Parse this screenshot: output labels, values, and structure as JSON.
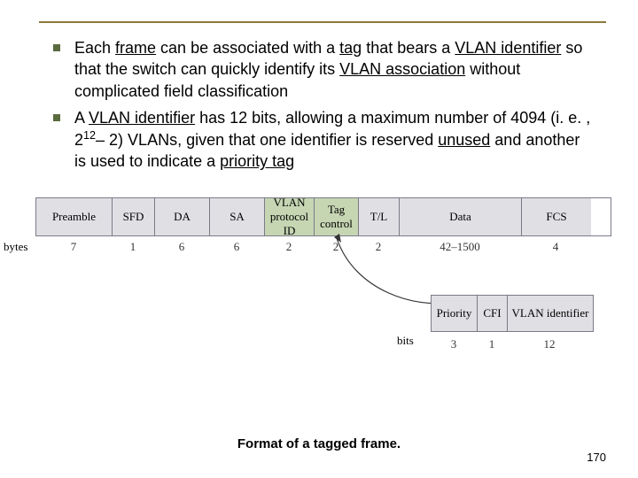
{
  "bullets": [
    {
      "pre1": "Each ",
      "u1": "frame",
      "mid1": " can be associated with a ",
      "u2": "tag",
      "mid2": " that bears a ",
      "u3": "VLAN identifier",
      "mid3": " so that the switch can quickly identify its ",
      "u4": "VLAN association",
      "mid4": " without complicated field classification"
    },
    {
      "pre1": "A ",
      "u1": "VLAN identifier",
      "mid1": " has 12 bits, allowing a maximum number of 4094 (i. e. , 2",
      "sup": "12",
      "mid2": "– 2) VLANs, given that one identifier is reserved ",
      "u2": "unused",
      "mid3": " and another is used to indicate a ",
      "u3": "priority tag"
    }
  ],
  "frame": {
    "cells": [
      {
        "label": "Preamble",
        "w": 86,
        "cls": "c-gray",
        "bytes": "7"
      },
      {
        "label": "SFD",
        "w": 48,
        "cls": "c-gray",
        "bytes": "1"
      },
      {
        "label": "DA",
        "w": 62,
        "cls": "c-gray",
        "bytes": "6"
      },
      {
        "label": "SA",
        "w": 62,
        "cls": "c-gray",
        "bytes": "6"
      },
      {
        "label": "VLAN protocol ID",
        "w": 56,
        "cls": "c-green",
        "bytes": "2"
      },
      {
        "label": "Tag control",
        "w": 50,
        "cls": "c-green",
        "bytes": "2"
      },
      {
        "label": "T/L",
        "w": 46,
        "cls": "c-gray",
        "bytes": "2"
      },
      {
        "label": "Data",
        "w": 138,
        "cls": "c-gray",
        "bytes": "42–1500"
      },
      {
        "label": "FCS",
        "w": 78,
        "cls": "c-gray",
        "bytes": "4"
      }
    ],
    "bytes_label": "bytes"
  },
  "sub": {
    "cells": [
      {
        "label": "Priority",
        "w": 52,
        "bits": "3"
      },
      {
        "label": "CFI",
        "w": 34,
        "bits": "1"
      },
      {
        "label": "VLAN identifier",
        "w": 96,
        "bits": "12"
      }
    ],
    "bits_label": "bits"
  },
  "caption": "Format of a tagged frame.",
  "pagenum": "170"
}
